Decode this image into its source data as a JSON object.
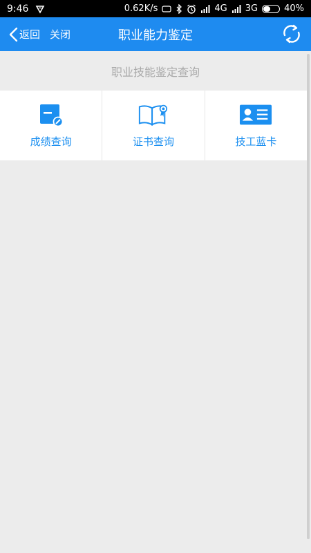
{
  "status_bar": {
    "time": "9:46",
    "speed": "0.62K/s",
    "net_4g": "4G",
    "net_3g": "3G",
    "battery": "40%",
    "battery_level": 0.4
  },
  "app_bar": {
    "back_label": "返回",
    "close_label": "关闭",
    "title": "职业能力鉴定"
  },
  "section": {
    "title": "职业技能鉴定查询"
  },
  "menu": [
    {
      "label": "成绩查询",
      "icon": "score-icon"
    },
    {
      "label": "证书查询",
      "icon": "certificate-icon"
    },
    {
      "label": "技工蓝卡",
      "icon": "id-card-icon"
    }
  ],
  "colors": {
    "accent": "#1e8bf0",
    "label": "#1b8ff0",
    "background": "#ececec"
  }
}
